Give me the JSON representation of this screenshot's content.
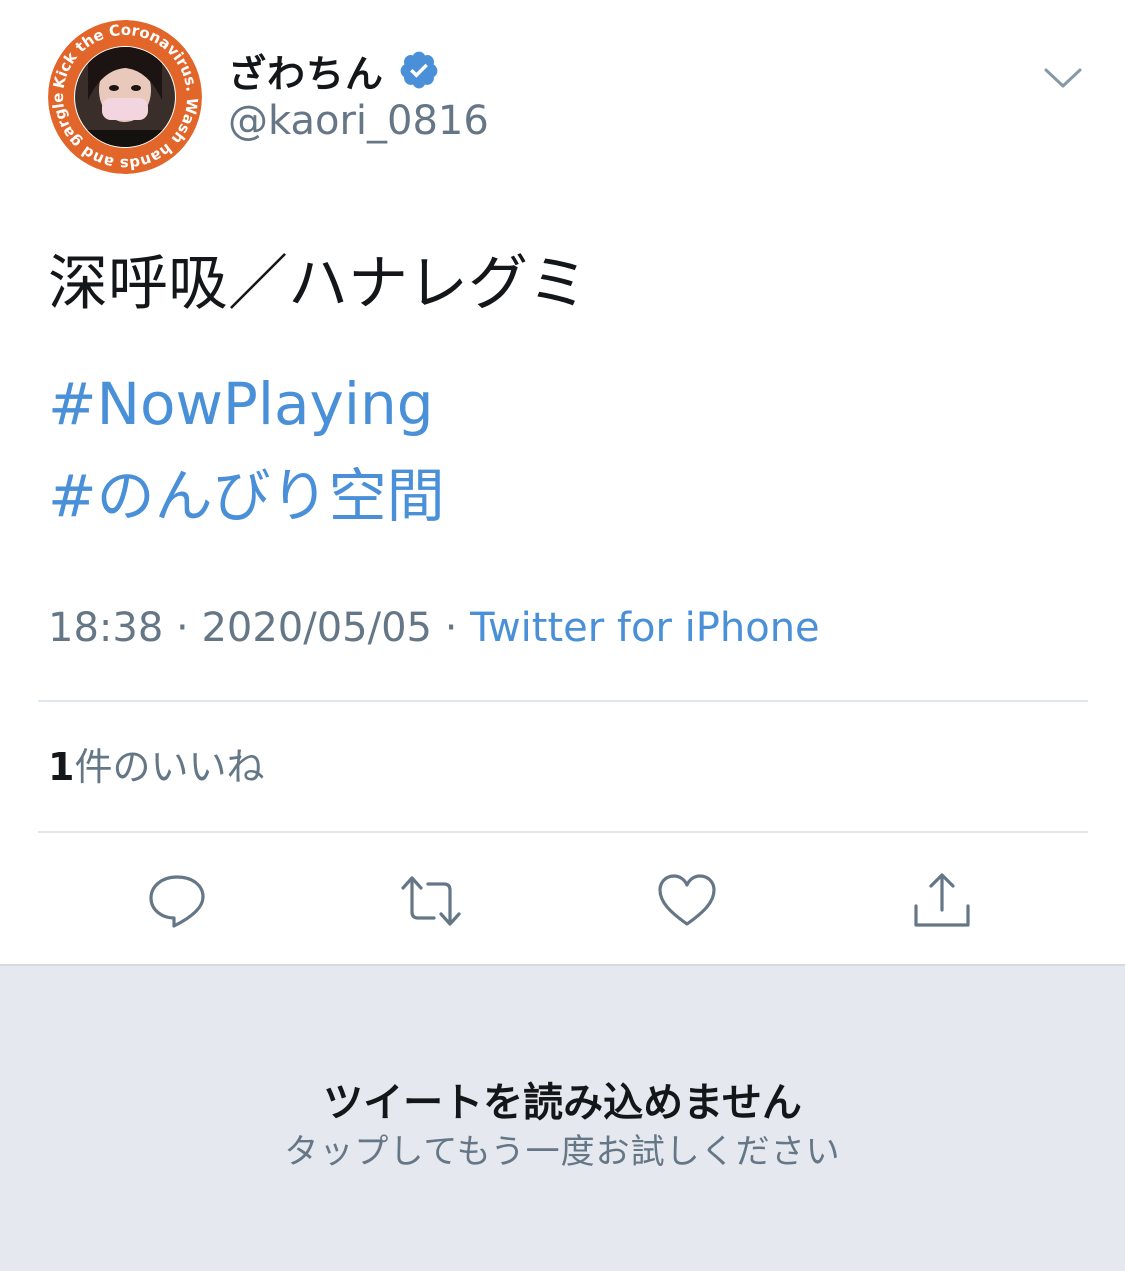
{
  "author": {
    "display_name": "ざわちん",
    "handle": "@kaori_0816",
    "avatar_ring_text": "Kick the Coronavirus. Wash hands and gargle.",
    "verified_icon": "verified-badge-icon"
  },
  "tweet": {
    "text": "深呼吸／ハナレグミ",
    "hashtags": [
      "#NowPlaying",
      "#のんびり空間"
    ],
    "time": "18:38",
    "date": "2020/05/05",
    "separator": " · ",
    "source": "Twitter for iPhone"
  },
  "stats": {
    "like_count": "1",
    "like_label": "件のいいね"
  },
  "actions": {
    "reply_icon": "reply-icon",
    "retweet_icon": "retweet-icon",
    "like_icon": "heart-icon",
    "share_icon": "share-icon"
  },
  "error": {
    "title": "ツイートを読み込めません",
    "subtitle": "タップしてもう一度お試しください"
  },
  "colors": {
    "link": "#4a90d9",
    "muted": "#657786",
    "avatar_ring": "#e2652a",
    "error_bg": "#e6e8ef"
  }
}
